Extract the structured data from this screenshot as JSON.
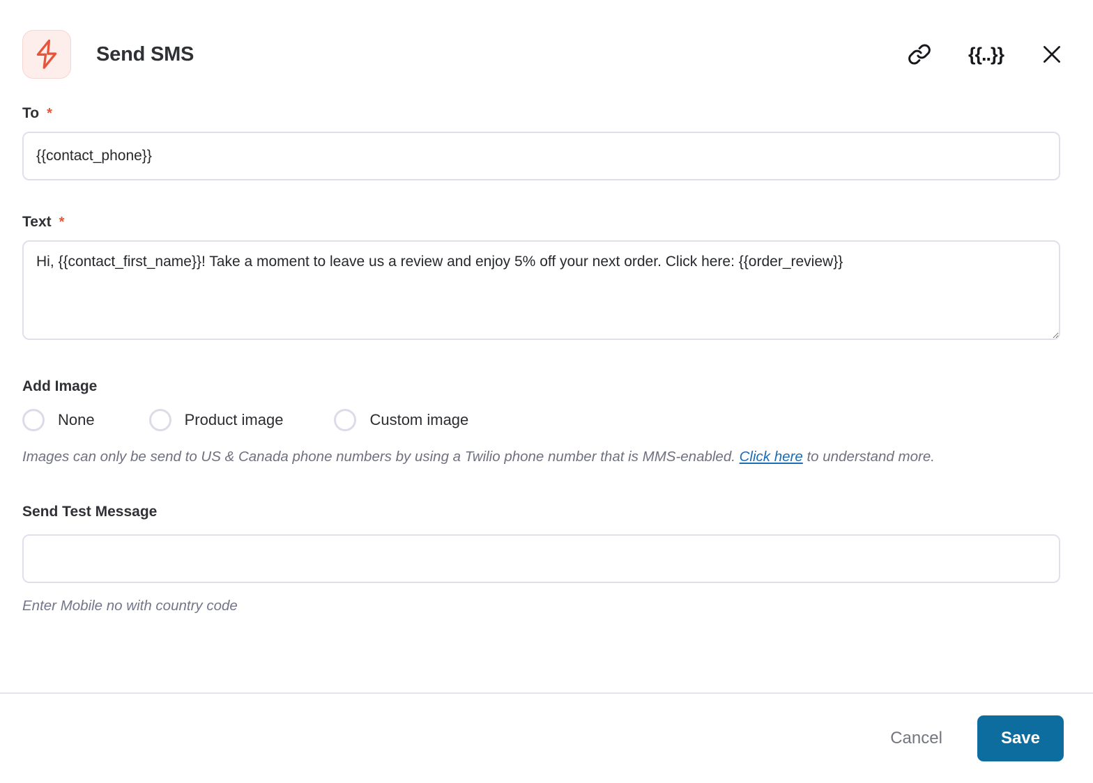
{
  "header": {
    "title": "Send SMS",
    "icon_name": "lightning-bolt-icon",
    "icon_color": "#e8543a",
    "icon_bg": "#fdeeec",
    "actions": [
      {
        "name": "link-icon",
        "label": ""
      },
      {
        "name": "merge-tag-icon",
        "label": "{{..}}"
      },
      {
        "name": "close-icon",
        "label": ""
      }
    ]
  },
  "fields": {
    "to": {
      "label": "To",
      "required_marker": "*",
      "value": "{{contact_phone}}",
      "placeholder": ""
    },
    "text": {
      "label": "Text",
      "required_marker": "*",
      "value": "Hi, {{contact_first_name}}! Take a moment to leave us a review and enjoy 5% off your next order. Click here: {{order_review}}",
      "placeholder": ""
    },
    "add_image": {
      "label": "Add Image",
      "options": [
        {
          "label": "None",
          "selected": false
        },
        {
          "label": "Product image",
          "selected": false
        },
        {
          "label": "Custom image",
          "selected": false
        }
      ],
      "helper_text_before": "Images can only be send to US & Canada phone numbers by using a Twilio phone number that is MMS-enabled. ",
      "helper_link": "Click here",
      "helper_text_after": " to understand more."
    },
    "send_test_message": {
      "label": "Send Test Message",
      "value": "",
      "placeholder": "",
      "helper_text": "Enter Mobile no with country code"
    }
  },
  "footer": {
    "cancel_label": "Cancel",
    "save_label": "Save",
    "save_color": "#0d6d9e"
  }
}
